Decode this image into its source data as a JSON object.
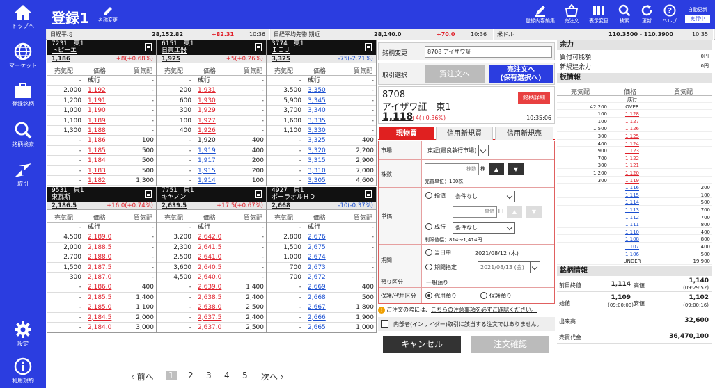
{
  "nav": {
    "items": [
      {
        "label": "トップへ"
      },
      {
        "label": "マーケット"
      },
      {
        "label": "登録銘柄"
      },
      {
        "label": "銘柄検索"
      },
      {
        "label": "取引"
      },
      {
        "label": "設定"
      },
      {
        "label": "利用規約"
      }
    ]
  },
  "header": {
    "title": "登録1",
    "rename_label": "名称変更",
    "icons": [
      {
        "label": "登録内容編集"
      },
      {
        "label": "売注文"
      },
      {
        "label": "表示変更"
      },
      {
        "label": "検索"
      },
      {
        "label": "更新"
      },
      {
        "label": "ヘルプ"
      }
    ],
    "auto_update_label": "自動更新",
    "auto_update_state": "実行中"
  },
  "tickers": [
    {
      "name": "日経平均",
      "value": "28,152.82",
      "change": "+82.31",
      "time": "10:36"
    },
    {
      "name": "日経平均先物 期近",
      "value": "28,140.0",
      "change": "+70.0",
      "time": "10:36"
    },
    {
      "name": "米ドル",
      "value": "110.3500 - 110.3900",
      "change": "",
      "time": "10:35"
    }
  ],
  "columns": {
    "sell": "売気配",
    "price": "価格",
    "buy": "買気配"
  },
  "panels": [
    {
      "code": "7231　東1",
      "name": "トピーエ",
      "price": "1,186",
      "change": "+8(+0.68%)",
      "change_color": "red",
      "rows": [
        [
          "-",
          "成行",
          "-"
        ],
        [
          "2,000",
          "1,192",
          "-"
        ],
        [
          "1,200",
          "1,191",
          "-"
        ],
        [
          "1,000",
          "1,190",
          "-"
        ],
        [
          "1,100",
          "1,189",
          "-"
        ],
        [
          "1,300",
          "1,188",
          "-"
        ],
        [
          "-",
          "1,186",
          "100"
        ],
        [
          "-",
          "1,185",
          "500"
        ],
        [
          "-",
          "1,184",
          "500"
        ],
        [
          "-",
          "1,183",
          "500"
        ],
        [
          "-",
          "1,182",
          "1,300"
        ]
      ],
      "colors": [
        "",
        "red",
        "red",
        "red",
        "red",
        "red",
        "red",
        "red",
        "red",
        "red",
        "red"
      ]
    },
    {
      "code": "6151　東1",
      "name": "日東工器",
      "price": "1,925",
      "change": "+5(+0.26%)",
      "change_color": "red",
      "rows": [
        [
          "-",
          "成行",
          "-"
        ],
        [
          "200",
          "1,931",
          "-"
        ],
        [
          "600",
          "1,930",
          "-"
        ],
        [
          "300",
          "1,929",
          "-"
        ],
        [
          "100",
          "1,927",
          "-"
        ],
        [
          "400",
          "1,926",
          "-"
        ],
        [
          "-",
          "1,920",
          "400"
        ],
        [
          "-",
          "1,919",
          "400"
        ],
        [
          "-",
          "1,917",
          "200"
        ],
        [
          "-",
          "1,915",
          "200"
        ],
        [
          "-",
          "1,914",
          "100"
        ]
      ],
      "colors": [
        "",
        "red",
        "red",
        "red",
        "red",
        "red",
        "",
        "blue",
        "blue",
        "blue",
        "blue"
      ]
    },
    {
      "code": "3774　東1",
      "name": "ＩＩＪ",
      "price": "3,325",
      "change": "-75(-2.21%)",
      "change_color": "blue",
      "rows": [
        [
          "-",
          "成行",
          "-"
        ],
        [
          "3,500",
          "3,350",
          "-"
        ],
        [
          "5,900",
          "3,345",
          "-"
        ],
        [
          "3,700",
          "3,340",
          "-"
        ],
        [
          "1,600",
          "3,335",
          "-"
        ],
        [
          "1,100",
          "3,330",
          "-"
        ],
        [
          "-",
          "3,325",
          "400"
        ],
        [
          "-",
          "3,320",
          "2,200"
        ],
        [
          "-",
          "3,315",
          "2,900"
        ],
        [
          "-",
          "3,310",
          "7,000"
        ],
        [
          "-",
          "3,305",
          "4,600"
        ]
      ],
      "colors": [
        "",
        "blue",
        "blue",
        "blue",
        "blue",
        "blue",
        "blue",
        "blue",
        "blue",
        "blue",
        "blue"
      ]
    },
    {
      "code": "9531　東1",
      "name": "東瓦斯",
      "price": "2,186.5",
      "change": "+16.0(+0.74%)",
      "change_color": "red",
      "rows": [
        [
          "-",
          "成行",
          "-"
        ],
        [
          "4,500",
          "2,189.0",
          "-"
        ],
        [
          "2,000",
          "2,188.5",
          "-"
        ],
        [
          "2,700",
          "2,188.0",
          "-"
        ],
        [
          "1,500",
          "2,187.5",
          "-"
        ],
        [
          "300",
          "2,187.0",
          "-"
        ],
        [
          "-",
          "2,186.0",
          "400"
        ],
        [
          "-",
          "2,185.5",
          "1,400"
        ],
        [
          "-",
          "2,185.0",
          "1,100"
        ],
        [
          "-",
          "2,184.5",
          "2,000"
        ],
        [
          "-",
          "2,184.0",
          "3,000"
        ]
      ],
      "colors": [
        "",
        "red",
        "red",
        "red",
        "red",
        "red",
        "red",
        "red",
        "red",
        "red",
        "red"
      ]
    },
    {
      "code": "7751　東1",
      "name": "キヤノン",
      "price": "2,639.5",
      "change": "+17.5(+0.67%)",
      "change_color": "red",
      "rows": [
        [
          "-",
          "成行",
          "-"
        ],
        [
          "3,200",
          "2,642.0",
          "-"
        ],
        [
          "2,300",
          "2,641.5",
          "-"
        ],
        [
          "2,500",
          "2,641.0",
          "-"
        ],
        [
          "3,600",
          "2,640.5",
          "-"
        ],
        [
          "4,500",
          "2,640.0",
          "-"
        ],
        [
          "-",
          "2,639.0",
          "1,400"
        ],
        [
          "-",
          "2,638.5",
          "2,400"
        ],
        [
          "-",
          "2,638.0",
          "2,500"
        ],
        [
          "-",
          "2,637.5",
          "2,400"
        ],
        [
          "-",
          "2,637.0",
          "2,500"
        ]
      ],
      "colors": [
        "",
        "red",
        "red",
        "red",
        "red",
        "red",
        "red",
        "red",
        "red",
        "red",
        "red"
      ]
    },
    {
      "code": "4927　東1",
      "name": "ポーラオルＨＤ",
      "price": "2,668",
      "change": "-10(-0.37%)",
      "change_color": "blue",
      "rows": [
        [
          "-",
          "成行",
          "-"
        ],
        [
          "2,800",
          "2,676",
          "-"
        ],
        [
          "1,500",
          "2,675",
          "-"
        ],
        [
          "1,000",
          "2,674",
          "-"
        ],
        [
          "700",
          "2,673",
          "-"
        ],
        [
          "700",
          "2,672",
          "-"
        ],
        [
          "-",
          "2,669",
          "400"
        ],
        [
          "-",
          "2,668",
          "500"
        ],
        [
          "-",
          "2,667",
          "1,800"
        ],
        [
          "-",
          "2,666",
          "1,900"
        ],
        [
          "-",
          "2,665",
          "1,000"
        ]
      ],
      "colors": [
        "",
        "blue",
        "blue",
        "blue",
        "blue",
        "blue",
        "blue",
        "blue",
        "blue",
        "blue",
        "blue"
      ]
    }
  ],
  "pager": {
    "prev": "前へ",
    "pages": [
      "1",
      "2",
      "3",
      "4",
      "5"
    ],
    "current": "1",
    "next": "次へ"
  },
  "order": {
    "change_label": "銘柄変更",
    "stock_box": "8708 アイザワ証",
    "trade_select_label": "取引選択",
    "buy_button": "買注文へ",
    "sell_button_l1": "売注文へ",
    "sell_button_l2": "(保有選択へ)",
    "code": "8708",
    "name": "アイザワ証　東1",
    "price": "1,118",
    "change": "+4(+0.36%)",
    "time": "10:35:06",
    "detail_button": "銘柄詳細",
    "tabs": [
      "現物買",
      "信用新規買",
      "信用新規売"
    ],
    "market_label": "市場",
    "market_value": "東証(最良執行市場)",
    "qty_label": "株数",
    "qty_placeholder": "株数",
    "qty_unit": "株",
    "qty_lot": "売買単位：100株",
    "price_label": "単価",
    "limit_label": "指値",
    "limit_cond": "条件なし",
    "price_placeholder": "単価",
    "price_unit": "円",
    "market_order_label": "成行",
    "market_cond": "条件なし",
    "limit_range": "制限値幅：814～1,414円",
    "period_label": "期間",
    "today_label": "当日中",
    "today_date": "2021/08/12 (木)",
    "period_spec_label": "期間指定",
    "period_date": "2021/08/13 (金)",
    "deposit_label": "預り区分",
    "deposit_value": "一般預り",
    "custody_label": "保護/代用区分",
    "substitute_label": "代用預り",
    "protect_label": "保護預り",
    "notice_prefix": "ご注文の際には、",
    "notice_link": "こちらの注意事項を必ずご確認ください。",
    "insider_text": "内部者(インサイダー)取引に該当する注文ではありません。",
    "cancel_button": "キャンセル",
    "confirm_button": "注文確認"
  },
  "right": {
    "margin_title": "余力",
    "margin_rows": [
      {
        "label": "買付可能額",
        "value": "0円"
      },
      {
        "label": "新規建余力",
        "value": "0円"
      }
    ],
    "board_title": "板情報",
    "board_rows": [
      [
        "",
        "成行",
        ""
      ],
      [
        "42,200",
        "OVER",
        ""
      ],
      [
        "100",
        "1,128",
        ""
      ],
      [
        "100",
        "1,127",
        ""
      ],
      [
        "1,500",
        "1,126",
        ""
      ],
      [
        "300",
        "1,125",
        ""
      ],
      [
        "400",
        "1,124",
        ""
      ],
      [
        "900",
        "1,123",
        ""
      ],
      [
        "700",
        "1,122",
        ""
      ],
      [
        "300",
        "1,121",
        ""
      ],
      [
        "1,200",
        "1,120",
        ""
      ],
      [
        "300",
        "1,119",
        ""
      ],
      [
        "",
        "1,116",
        "200"
      ],
      [
        "",
        "1,115",
        "100"
      ],
      [
        "",
        "1,114",
        "500"
      ],
      [
        "",
        "1,113",
        "700"
      ],
      [
        "",
        "1,112",
        "700"
      ],
      [
        "",
        "1,111",
        "800"
      ],
      [
        "",
        "1,110",
        "400"
      ],
      [
        "",
        "1,108",
        "800"
      ],
      [
        "",
        "1,107",
        "400"
      ],
      [
        "",
        "1,106",
        "500"
      ],
      [
        "",
        "UNDER",
        "19,900"
      ]
    ],
    "info_title": "銘柄情報",
    "info": {
      "prev_close_label": "前日終値",
      "prev_close": "1,114",
      "high_label": "高値",
      "high": "1,140",
      "high_time": "(09:29:52)",
      "open_label": "始値",
      "open": "1,109",
      "open_time": "(09:00:00)",
      "low_label": "安値",
      "low": "1,102",
      "low_time": "(09:00:16)",
      "volume_label": "出来高",
      "volume": "32,600",
      "turnover_label": "売買代金",
      "turnover": "36,470,100"
    }
  },
  "colors": {
    "brand": "#2b3de0",
    "up": "#e0202a",
    "down": "#1a4fd0"
  }
}
